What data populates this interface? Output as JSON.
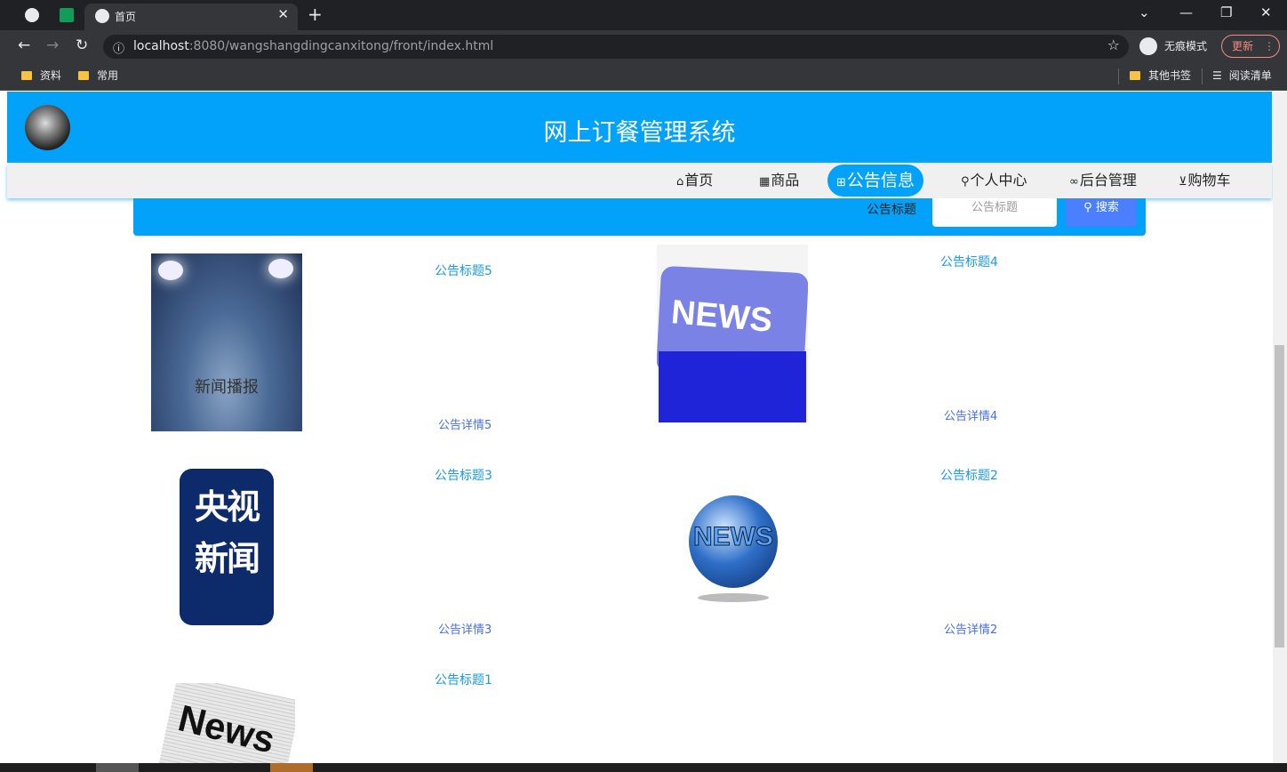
{
  "browser": {
    "tab_title": "首页",
    "url_host": "localhost",
    "url_rest": ":8080/wangshangdingcanxitong/front/index.html",
    "incognito_label": "无痕模式",
    "update_label": "更新",
    "bookmarks": [
      "资料",
      "常用"
    ],
    "bookmarks_right": [
      "其他书签",
      "阅读清单"
    ]
  },
  "site": {
    "title": "网上订餐管理系统"
  },
  "nav": {
    "items": [
      {
        "icon": "home-icon",
        "label": "首页"
      },
      {
        "icon": "grid-icon",
        "label": "商品"
      },
      {
        "icon": "gift-icon",
        "label": "公告信息"
      },
      {
        "icon": "user-icon",
        "label": "个人中心"
      },
      {
        "icon": "link-icon",
        "label": "后台管理"
      },
      {
        "icon": "cart-icon",
        "label": "购物车"
      }
    ]
  },
  "search": {
    "label": "公告标题",
    "placeholder": "公告标题",
    "button": "搜索"
  },
  "notices": [
    {
      "title": "公告标题5",
      "detail": "公告详情5",
      "image_text": "新闻播报"
    },
    {
      "title": "公告标题4",
      "detail": "公告详情4",
      "image_text": "NEWS"
    },
    {
      "title": "公告标题3",
      "detail": "公告详情3",
      "image_text": "央视新闻"
    },
    {
      "title": "公告标题2",
      "detail": "公告详情2",
      "image_text": "NEWS"
    },
    {
      "title": "公告标题1",
      "detail": "",
      "image_text": "News"
    }
  ]
}
